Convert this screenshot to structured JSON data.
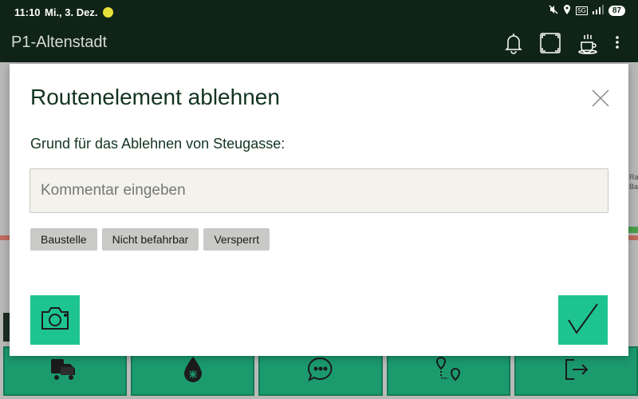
{
  "status_bar": {
    "time": "11:10",
    "date": "Mi., 3. Dez.",
    "battery": "87",
    "network": "5G"
  },
  "app_bar": {
    "title": "P1-Altenstadt",
    "icons": [
      "bell-icon",
      "fullscreen-icon",
      "coffee-break-icon",
      "more-vert-icon"
    ]
  },
  "map": {
    "label_line1": "Ra",
    "label_line2": "Ba"
  },
  "dialog": {
    "title": "Routenelement ablehnen",
    "prompt": "Grund für das Ablehnen von Steugasse:",
    "comment_placeholder": "Kommentar eingeben",
    "comment_value": "",
    "chips": [
      "Baustelle",
      "Nicht befahrbar",
      "Versperrt"
    ],
    "actions": [
      "camera-icon",
      "checkmark-icon"
    ]
  },
  "bottom_nav": {
    "icons": [
      "truck-icon",
      "water-drop-icon",
      "chat-icon",
      "route-icon",
      "exit-icon"
    ]
  },
  "colors": {
    "app_bar": "#0f2417",
    "accent": "#1ec48f",
    "nav": "#1b9a6e",
    "chip": "#c9c9c7",
    "heading": "#123421"
  }
}
